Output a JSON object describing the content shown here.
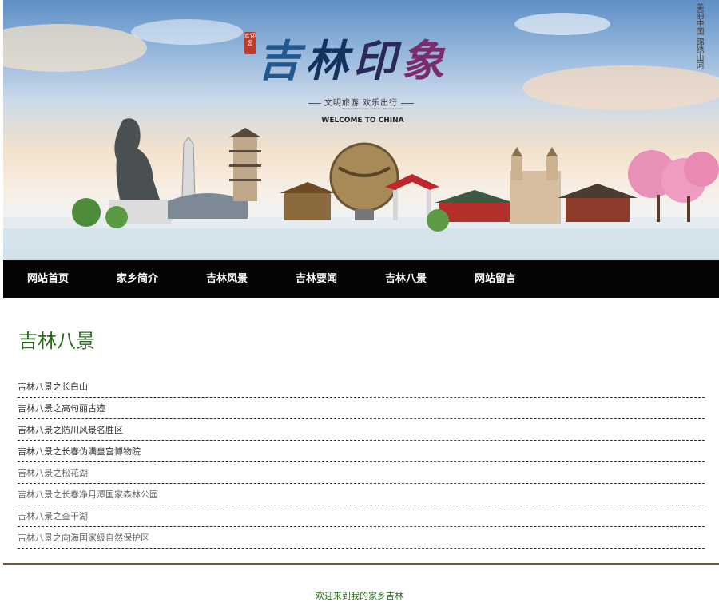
{
  "banner": {
    "title_chars": [
      "吉",
      "林",
      "印",
      "象"
    ],
    "welcome_seal": "欢迎您",
    "slogan": "文明旅游 欢乐出行",
    "small_text": "The Beautiful Scenery of China — Welcome to Jilin",
    "welcome_text": "WELCOME TO CHINA",
    "vertical_text": "美丽中国 锦绣山河"
  },
  "nav": {
    "items": [
      {
        "label": "网站首页"
      },
      {
        "label": "家乡简介"
      },
      {
        "label": "吉林风景"
      },
      {
        "label": "吉林要闻"
      },
      {
        "label": "吉林八景"
      },
      {
        "label": "网站留言"
      }
    ]
  },
  "main": {
    "title": "吉林八景",
    "articles": [
      {
        "label": "吉林八景之长白山"
      },
      {
        "label": "吉林八景之高句丽古迹"
      },
      {
        "label": "吉林八景之防川风景名胜区"
      },
      {
        "label": "吉林八景之长春伪满皇宫博物院"
      },
      {
        "label": "吉林八景之松花湖"
      },
      {
        "label": "吉林八景之长春净月潭国家森林公园"
      },
      {
        "label": "吉林八景之查干湖"
      },
      {
        "label": "吉林八景之向海国家级自然保护区"
      }
    ]
  },
  "footer": {
    "text": "欢迎来到我的家乡吉林"
  },
  "colors": {
    "nav_bg": "#050505",
    "title_green": "#2b6a1c",
    "divider": "#6b5a2e"
  }
}
